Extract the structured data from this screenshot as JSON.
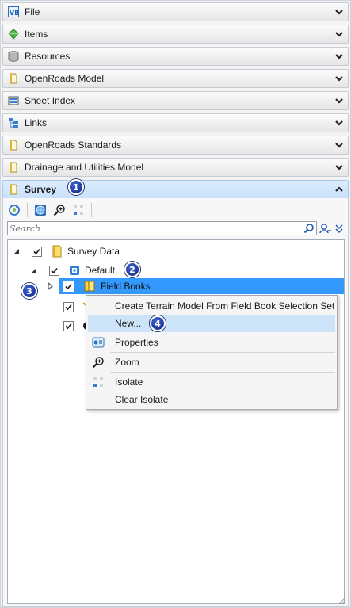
{
  "sections": [
    {
      "label": "File",
      "icon": "vb-file-icon"
    },
    {
      "label": "Items",
      "icon": "items-gem-icon"
    },
    {
      "label": "Resources",
      "icon": "database-icon"
    },
    {
      "label": "OpenRoads Model",
      "icon": "dgn-file-icon"
    },
    {
      "label": "Sheet Index",
      "icon": "sheet-index-icon"
    },
    {
      "label": "Links",
      "icon": "links-icon"
    },
    {
      "label": "OpenRoads Standards",
      "icon": "dgn-file-icon"
    },
    {
      "label": "Drainage and Utilities Model",
      "icon": "dgn-file-icon"
    }
  ],
  "survey": {
    "label": "Survey",
    "search_placeholder": "Search",
    "toolbar": [
      "refresh-icon",
      "globe-icon",
      "zoom-icon",
      "isolate-icon"
    ]
  },
  "tree": {
    "root": {
      "label": "Survey Data",
      "checked": true
    },
    "default": {
      "label": "Default",
      "checked": true
    },
    "field_books": {
      "label": "Field Books",
      "checked": true
    }
  },
  "context_menu": {
    "items": [
      {
        "label": "Create Terrain Model From Field Book Selection Set",
        "icon": ""
      },
      {
        "label": "New...",
        "icon": ""
      },
      {
        "label": "Properties",
        "icon": "properties-icon"
      },
      {
        "label": "Zoom",
        "icon": "zoom-icon"
      },
      {
        "label": "Isolate",
        "icon": "isolate-icon"
      },
      {
        "label": "Clear Isolate",
        "icon": ""
      }
    ]
  },
  "badges": [
    "1",
    "2",
    "3",
    "4"
  ],
  "colors": {
    "selection": "#3399ff",
    "badge": "#1b3399",
    "active_header": "#c9e1fb",
    "menu_hover": "#cde3f7"
  }
}
